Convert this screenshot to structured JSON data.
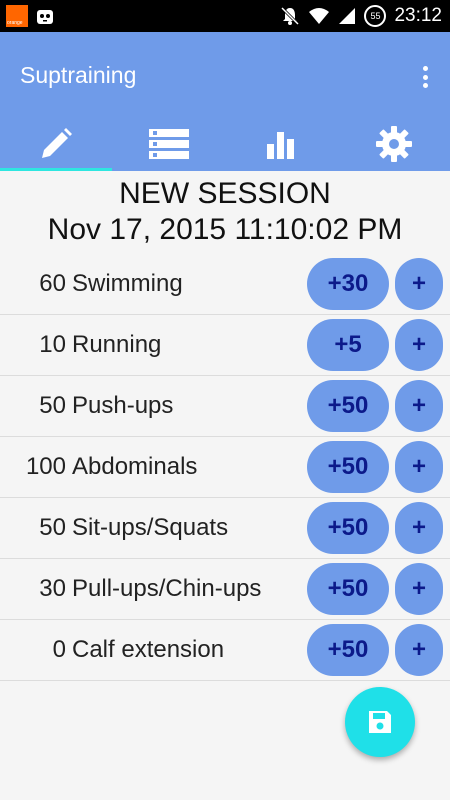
{
  "status_bar": {
    "carrier": "orange",
    "time": "23:12",
    "battery": "55"
  },
  "app_bar": {
    "title": "Suptraining",
    "tabs": [
      {
        "icon": "pencil-icon",
        "selected": true
      },
      {
        "icon": "list-icon",
        "selected": false
      },
      {
        "icon": "bar-chart-icon",
        "selected": false
      },
      {
        "icon": "gear-icon",
        "selected": false
      }
    ]
  },
  "session": {
    "title": "NEW SESSION",
    "date": "Nov 17, 2015 11:10:02 PM"
  },
  "exercises": [
    {
      "count": "60",
      "name": "Swimming",
      "increment": "+30",
      "plus": "+"
    },
    {
      "count": "10",
      "name": "Running",
      "increment": "+5",
      "plus": "+"
    },
    {
      "count": "50",
      "name": "Push-ups",
      "increment": "+50",
      "plus": "+"
    },
    {
      "count": "100",
      "name": "Abdominals",
      "increment": "+50",
      "plus": "+"
    },
    {
      "count": "50",
      "name": "Sit-ups/Squats",
      "increment": "+50",
      "plus": "+"
    },
    {
      "count": "30",
      "name": "Pull-ups/Chin-ups",
      "increment": "+50",
      "plus": "+"
    },
    {
      "count": "0",
      "name": "Calf extension",
      "increment": "+50",
      "plus": "+"
    }
  ],
  "fab": {
    "icon": "save-icon"
  },
  "colors": {
    "primary": "#6f9be9",
    "accent": "#1fe0e8",
    "button_text": "#0c1a8a"
  }
}
